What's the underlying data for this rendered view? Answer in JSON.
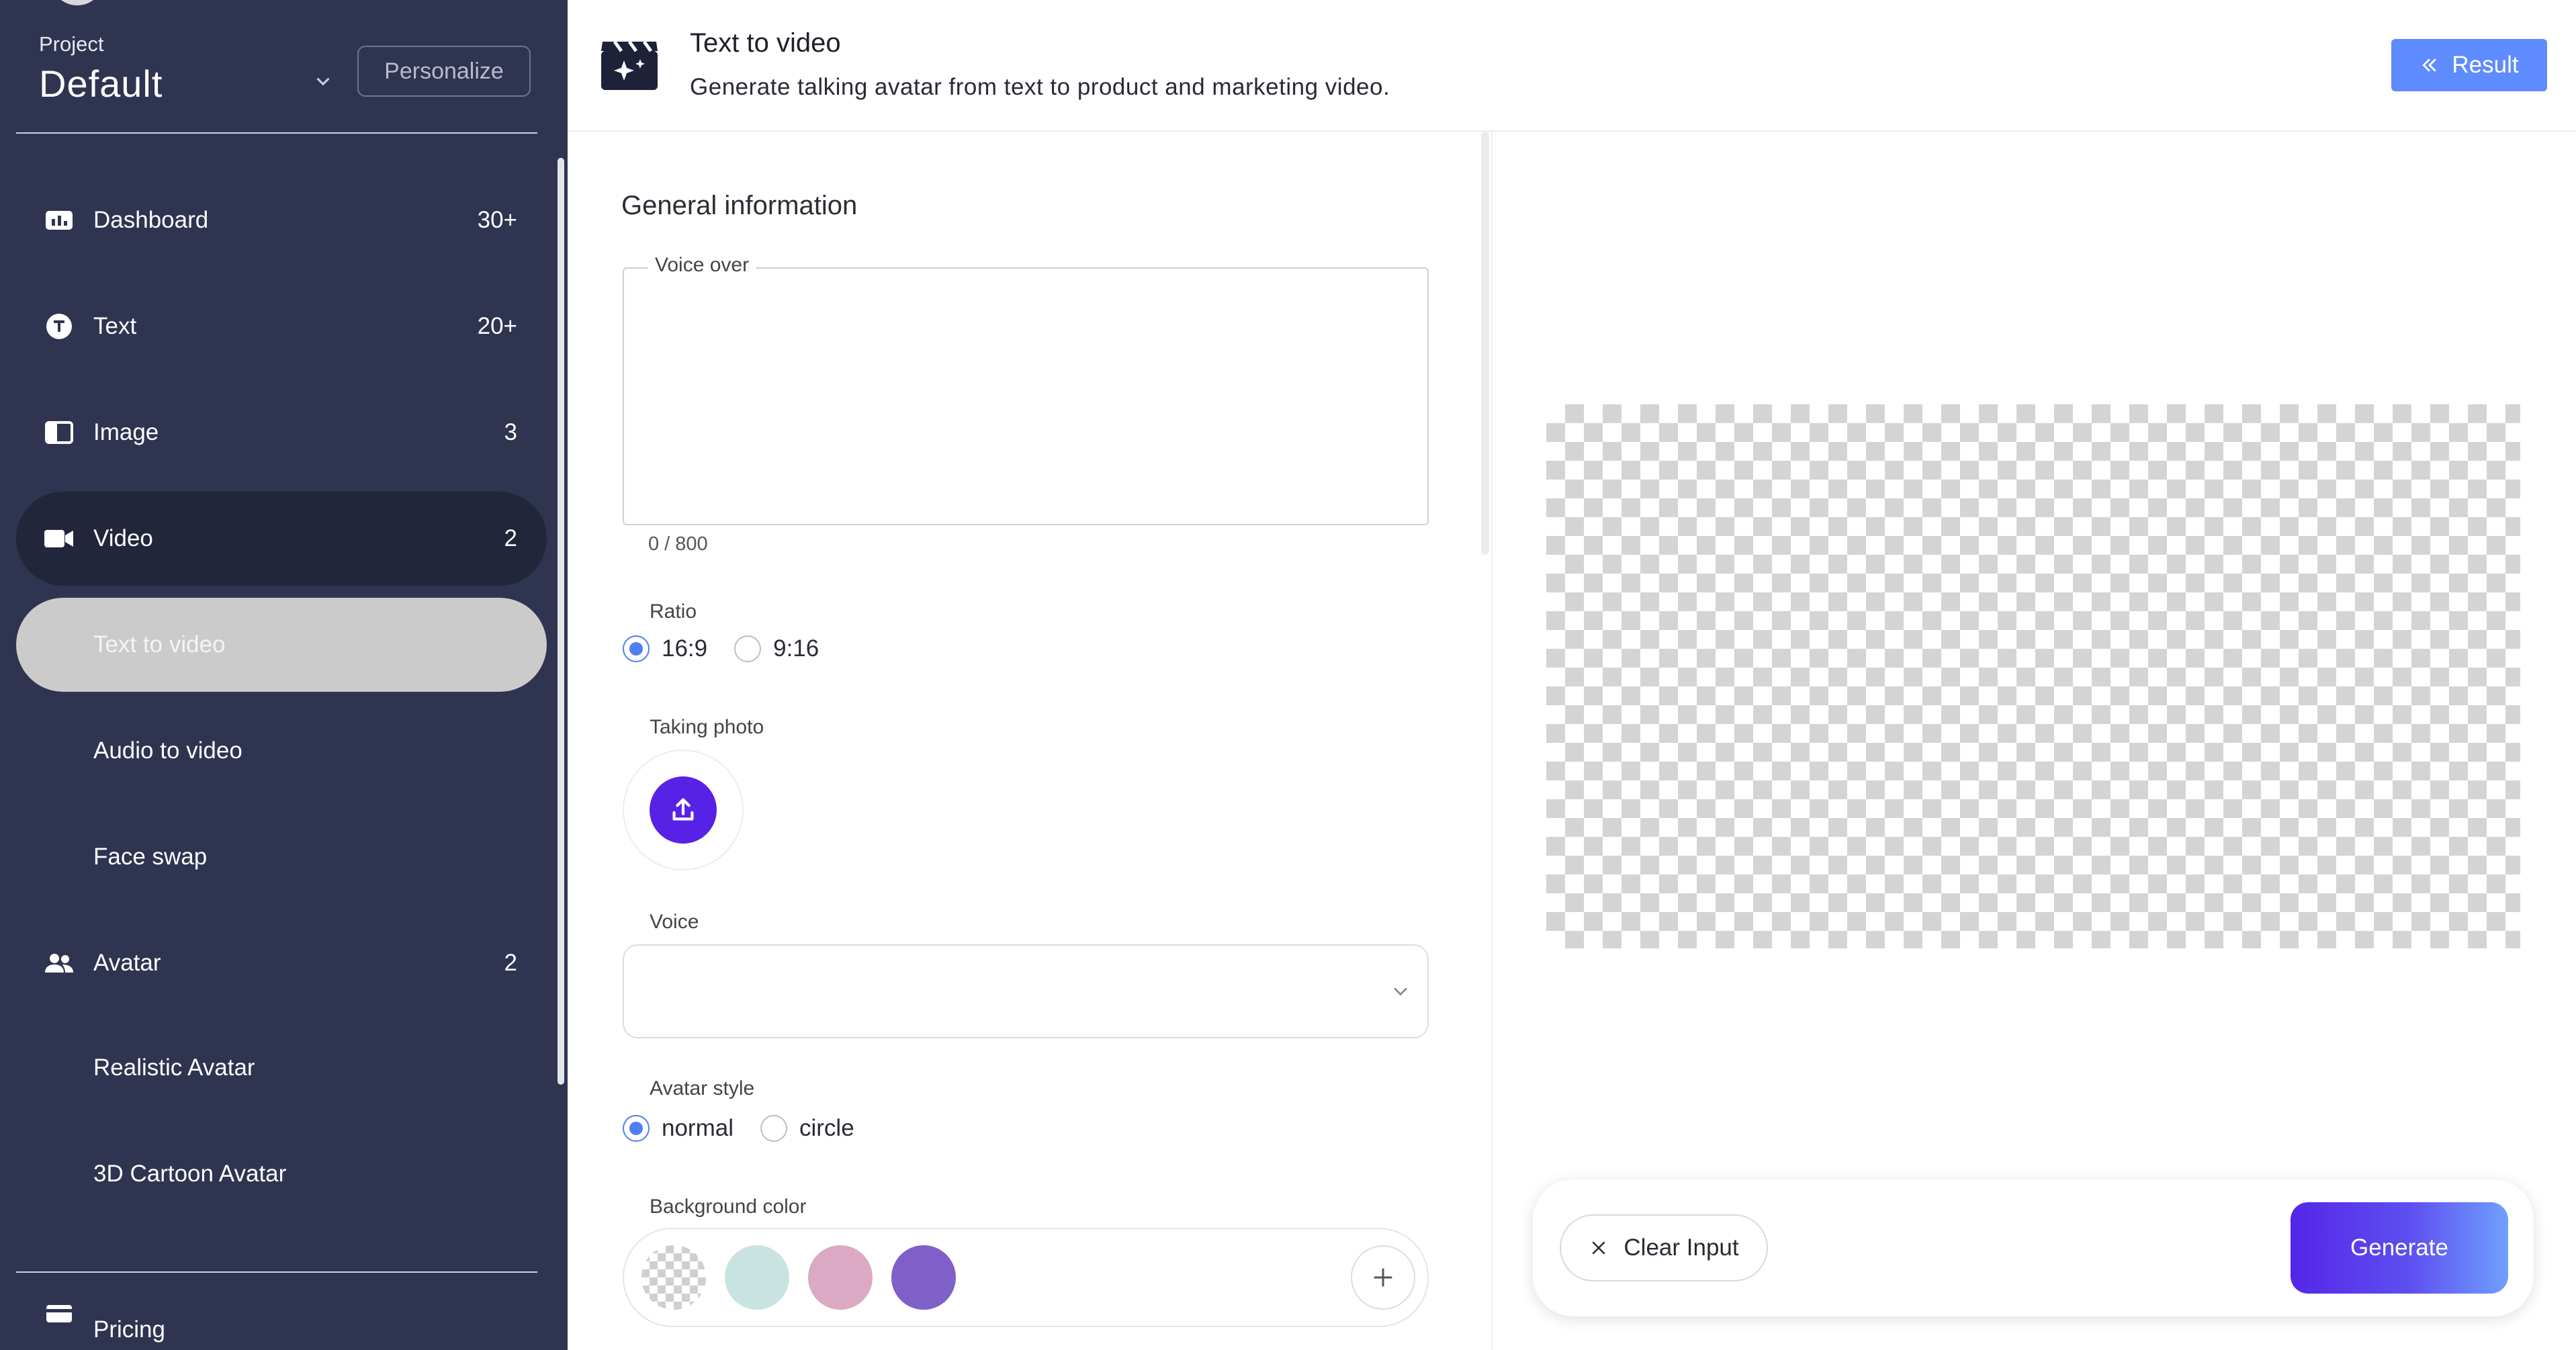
{
  "sidebar": {
    "project_label": "Project",
    "project_name": "Default",
    "personalize_label": "Personalize",
    "items": [
      {
        "label": "Dashboard",
        "count": "30+",
        "icon": "chart-icon"
      },
      {
        "label": "Text",
        "count": "20+",
        "icon": "text-icon"
      },
      {
        "label": "Image",
        "count": "3",
        "icon": "image-icon"
      },
      {
        "label": "Video",
        "count": "2",
        "icon": "video-camera-icon"
      },
      {
        "label": "Text to video"
      },
      {
        "label": "Audio to video"
      },
      {
        "label": "Face swap"
      },
      {
        "label": "Avatar",
        "count": "2",
        "icon": "people-icon"
      },
      {
        "label": "Realistic Avatar"
      },
      {
        "label": "3D Cartoon Avatar"
      },
      {
        "label": "Pricing",
        "icon": "card-icon"
      }
    ]
  },
  "header": {
    "title": "Text to video",
    "subtitle": "Generate talking avatar from text to product and marketing video.",
    "result_label": "Result",
    "icon": "clapperboard-sparkle-icon"
  },
  "form": {
    "section_title": "General information",
    "voice_over": {
      "label": "Voice over",
      "value": "",
      "count": "0 / 800"
    },
    "ratio": {
      "label": "Ratio",
      "options": [
        "16:9",
        "9:16"
      ],
      "selected": "16:9"
    },
    "taking_photo": {
      "label": "Taking photo"
    },
    "voice": {
      "label": "Voice",
      "value": ""
    },
    "avatar_style": {
      "label": "Avatar style",
      "options": [
        "normal",
        "circle"
      ],
      "selected": "normal"
    },
    "background_color": {
      "label": "Background color",
      "swatches": [
        "transparent",
        "#c9e3e1",
        "#dba9c3",
        "#7f5fc8"
      ]
    }
  },
  "actions": {
    "clear_label": "Clear Input",
    "generate_label": "Generate"
  },
  "colors": {
    "sidebar_bg": "#2f3450",
    "active_bg": "#22263a",
    "accent_blue": "#5e8cff",
    "upload_purple": "#5722e6"
  }
}
